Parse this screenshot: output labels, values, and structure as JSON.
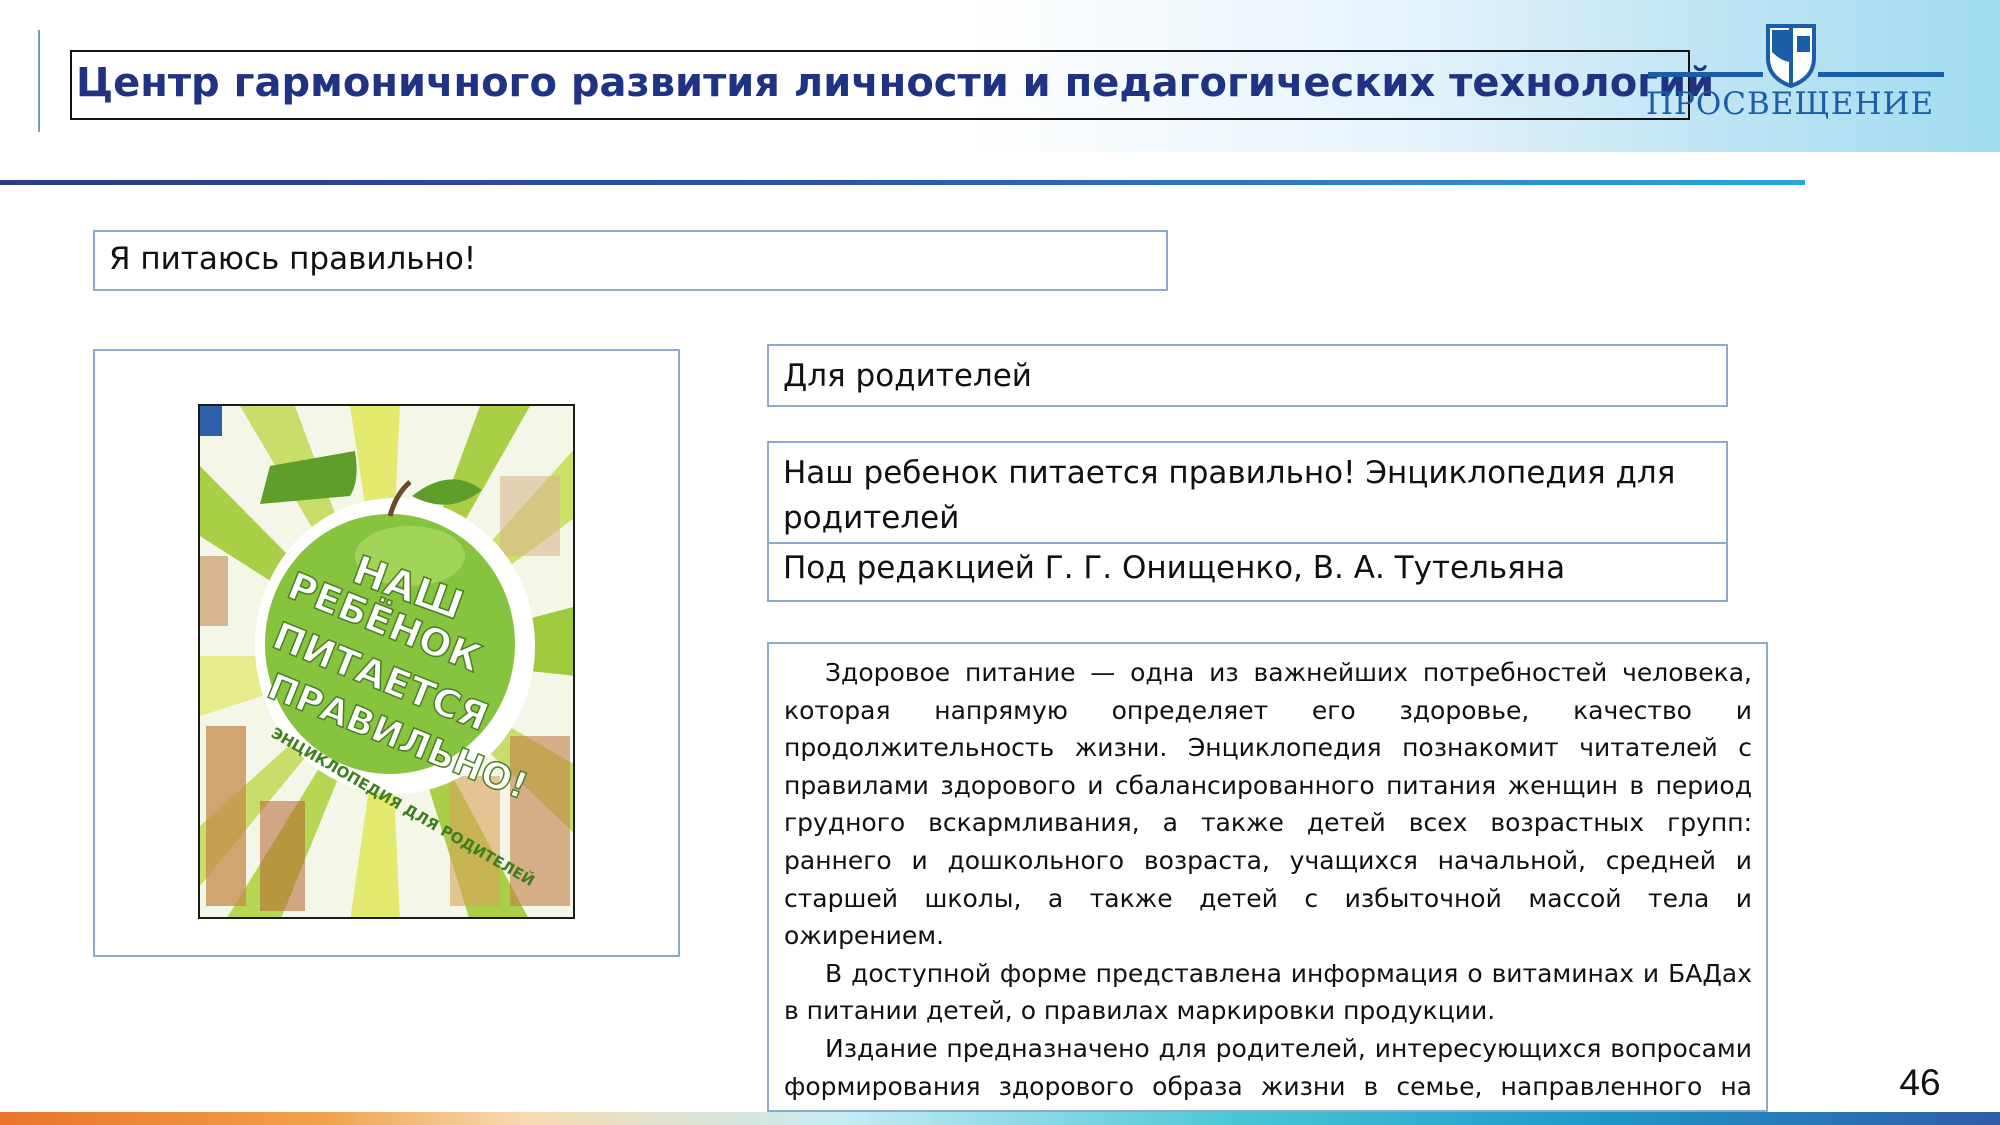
{
  "header": {
    "title": "Центр гармоничного развития личности и педагогических технологий",
    "logo_text": "ПРОСВЕЩЕНИЕ",
    "logo_icon": "prosveshchenie-shield-logo"
  },
  "section_label": "Я питаюсь правильно!",
  "book": {
    "audience": "Для родителей",
    "title": "Наш ребенок питается правильно! Энциклопедия для родителей",
    "editors": "Под редакцией Г. Г. Онищенко, В. А. Тутельяна",
    "description": [
      "Здоровое питание — одна из важнейших потребностей человека, которая напрямую определяет его здоровье, качество и продолжительность жизни. Энциклопедия познакомит читателей с правилами здорового и сбалансированного питания женщин в период грудного вскармливания, а также детей всех возрастных групп: раннего и дошкольного возраста, учащихся начальной, средней и старшей школы, а также детей с избыточной массой тела и ожирением.",
      "В доступной форме представлена информация о витаминах и БАДах в питании детей, о правилах маркировки продукции.",
      "Издание предназначено для родителей, интересующихся вопросами формирования здорового образа жизни в семье, направленного на сохранение и укрепление здоровья детей."
    ],
    "cover": {
      "title_lines": [
        "НАШ",
        "РЕБЁНОК",
        "ПИТАЕТСЯ",
        "ПРАВИЛЬНО!"
      ],
      "subtitle": "ЭНЦИКЛОПЕДИЯ ДЛЯ РОДИТЕЛЕЙ",
      "apple_color": "#86c43f",
      "apple_dark": "#5f9e2b"
    }
  },
  "page_number": "46",
  "colors": {
    "title_blue": "#1f3284",
    "logo_blue": "#1b5ea8",
    "box_border": "#8fa9cf"
  }
}
